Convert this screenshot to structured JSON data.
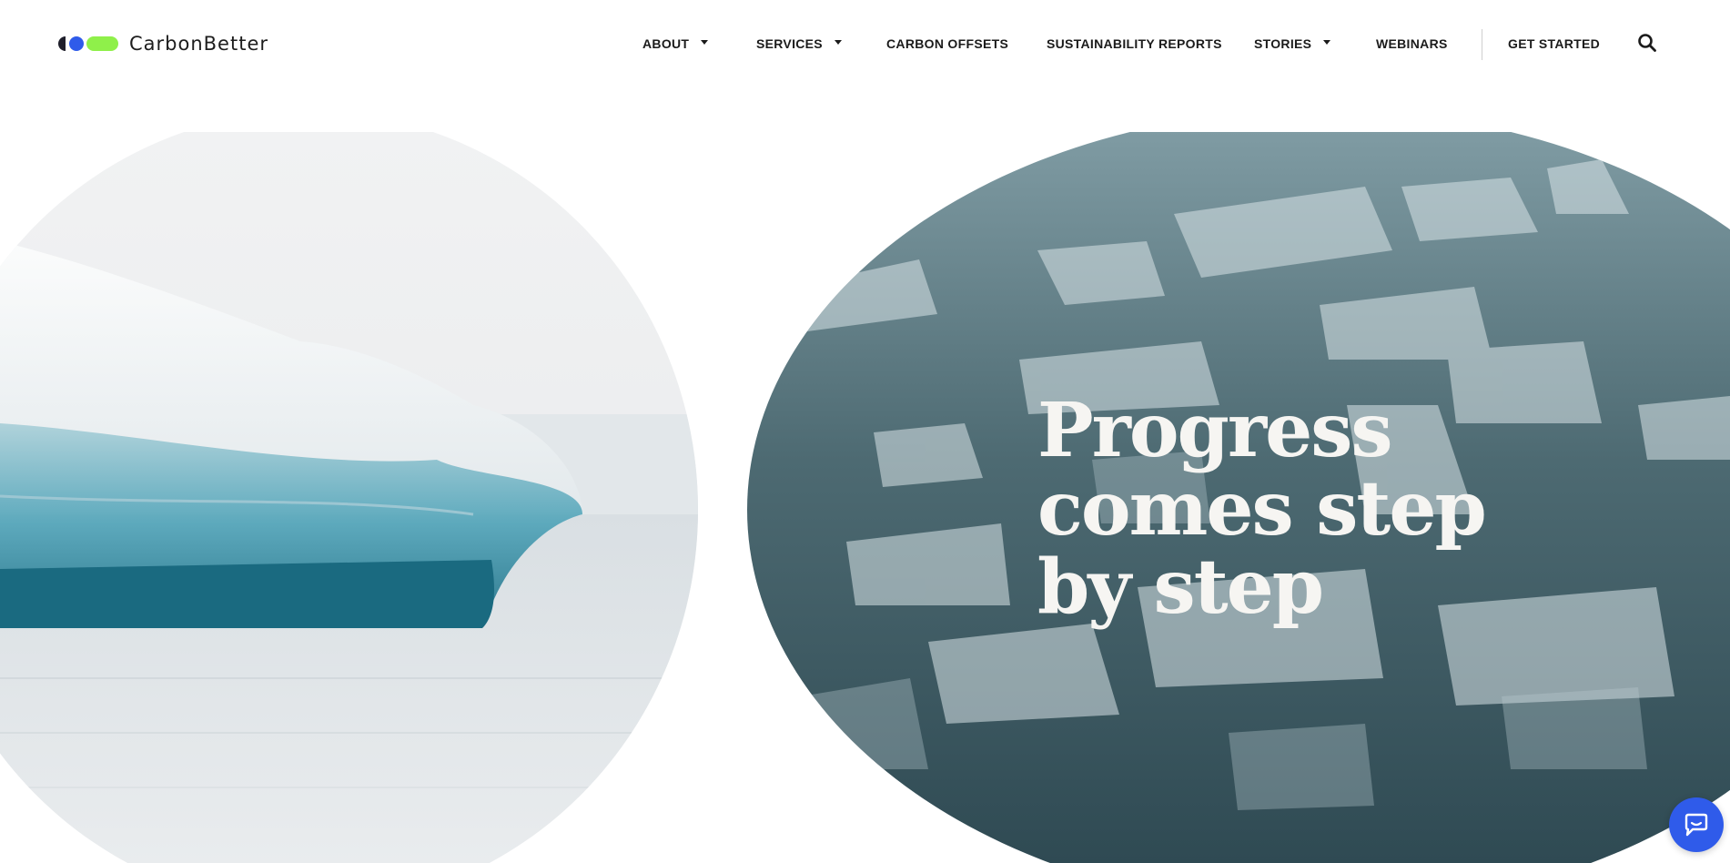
{
  "brand": {
    "name": "CarbonBetter"
  },
  "nav": {
    "items": [
      {
        "label": "ABOUT",
        "has_dropdown": true
      },
      {
        "label": "SERVICES",
        "has_dropdown": true
      },
      {
        "label": "CARBON OFFSETS",
        "has_dropdown": false
      },
      {
        "label": "SUSTAINABILITY REPORTS",
        "has_dropdown": false
      },
      {
        "label": "STORIES",
        "has_dropdown": true
      },
      {
        "label": "WEBINARS",
        "has_dropdown": false
      }
    ],
    "cta": "GET STARTED",
    "search_icon": "search-icon"
  },
  "hero": {
    "headline": [
      "Progress",
      "comes step",
      "by step"
    ],
    "images": [
      "iceberg-photo",
      "ice-floes-photo"
    ]
  },
  "chat": {
    "icon": "chat-bubble-icon"
  },
  "colors": {
    "accent_blue": "#2f5bea",
    "accent_green": "#8ff04a",
    "text_dark": "#1b1b1b",
    "headline_text": "#f6f5f2"
  }
}
